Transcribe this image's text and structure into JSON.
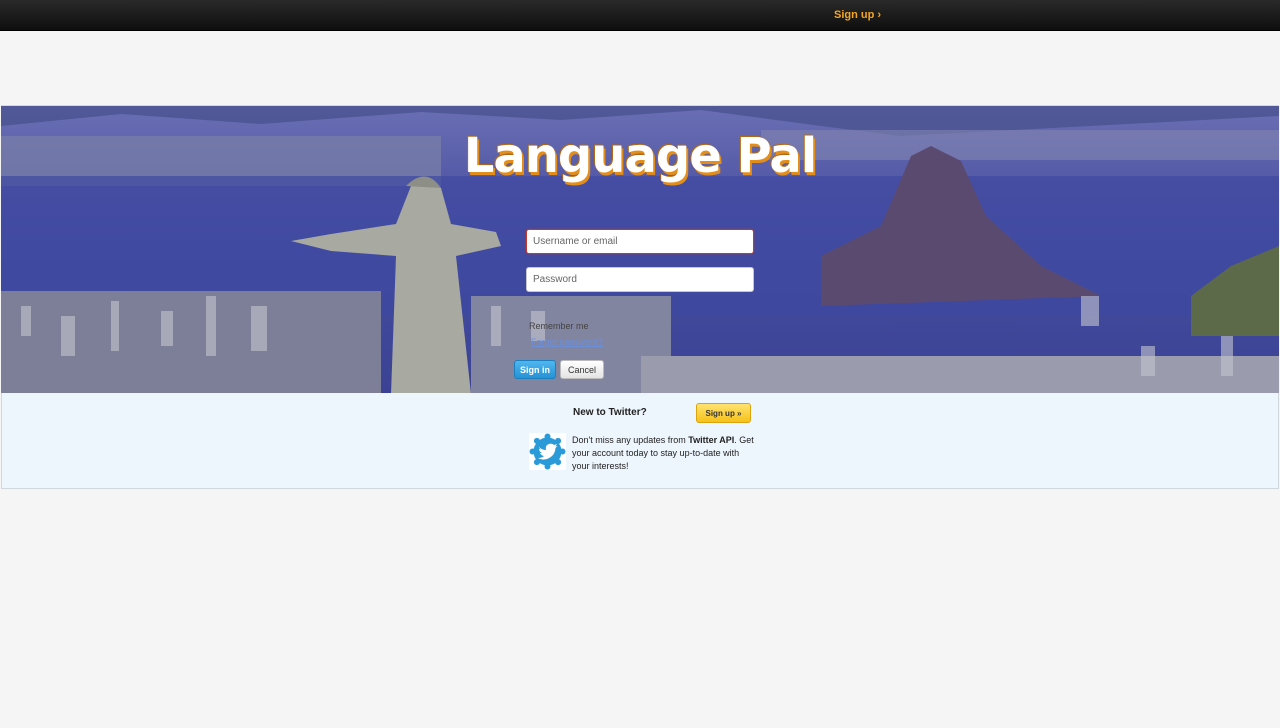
{
  "topbar": {
    "signup_label": "Sign up ›"
  },
  "banner": {
    "logo_text": "Language Pal"
  },
  "login": {
    "username_placeholder": "Username or email",
    "password_placeholder": "Password",
    "remember_label": "Remember me",
    "forgot_label": "Forgot password?",
    "signin_label": "Sign in",
    "cancel_label": "Cancel"
  },
  "signup_panel": {
    "new_to_label": "New to Twitter?",
    "signup_button_label": "Sign up »",
    "promo_prefix": "Don't miss any updates from ",
    "promo_account": "Twitter API",
    "promo_suffix": ". Get your account today to stay up-to-date with your interests!",
    "icon": "twitter-bird-icon"
  },
  "colors": {
    "topbar_bg": "#111111",
    "accent_orange": "#f5a623",
    "signin_blue": "#2693d6",
    "signup_yellow": "#f6c21a",
    "panel_bg": "#eef6fd"
  }
}
